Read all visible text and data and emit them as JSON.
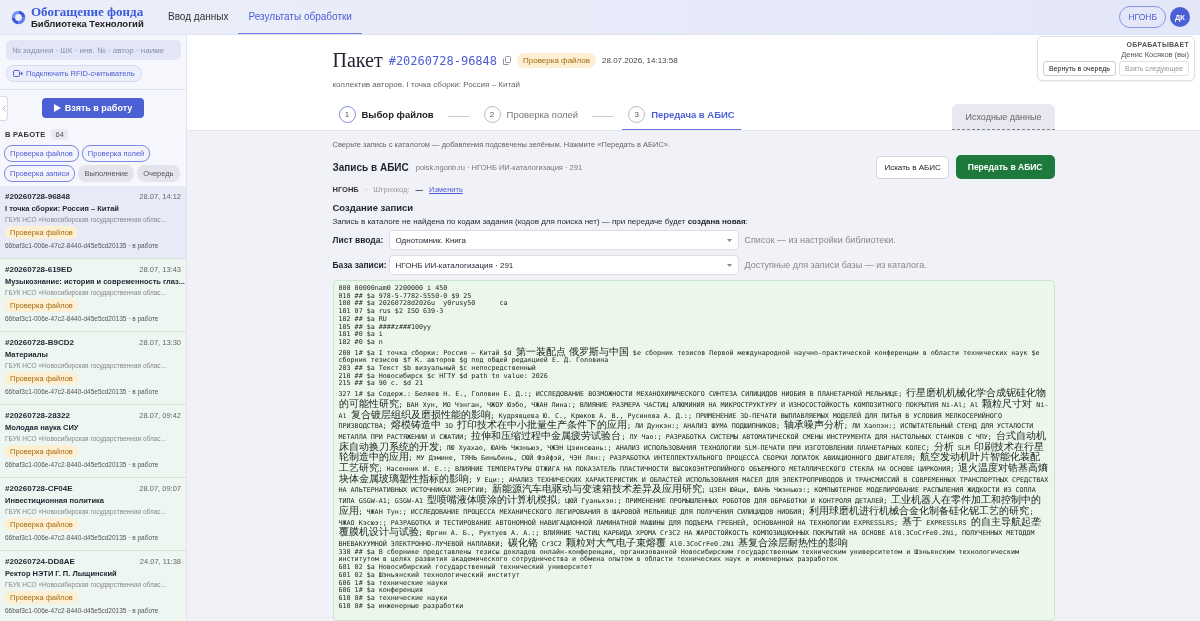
{
  "app": {
    "logo_title": "Обогащение фонда",
    "logo_subtitle": "Библиотека Технологий"
  },
  "nav": [
    {
      "label": "Ввод данных",
      "selected": false
    },
    {
      "label": "Результаты обработки",
      "selected": true
    }
  ],
  "org_badge": "НГОНБ",
  "avatar": "ДК",
  "sidebar": {
    "search": {
      "placeholder": "№ задания · ШК · инв. № · автор · наиме"
    },
    "rfid_button": "Подключить RFID-считыватель",
    "take_button": "Взять в работу",
    "section_label": "В РАБОТЕ",
    "count": "64",
    "filters": [
      {
        "label": "Проверка файлов",
        "selected": true
      },
      {
        "label": "Проверка полей",
        "selected": true
      },
      {
        "label": "Проверка записи",
        "selected": true
      },
      {
        "label": "Выполнение",
        "selected": false
      },
      {
        "label": "Очередь",
        "selected": false
      }
    ],
    "tasks": [
      {
        "id": "#20260728-96848",
        "date": "28.07, 14:12",
        "title": "I точка сборки: Россия – Китай",
        "org": "ГБУК НСО «Новосибирская государственная облас...",
        "status": "Проверка файлов",
        "meta": "66baf3c1-006e-47c2-8440-d45e5cd20135 · в работе",
        "selected": true
      },
      {
        "id": "#20260728-619ED",
        "date": "28.07, 13:43",
        "title": "Музыкознание: история и современность глаз...",
        "org": "ГБУК НСО «Новосибирская государственная облас...",
        "status": "Проверка файлов",
        "meta": "66baf3c1-006e-47c2-8440-d45e5cd20135 · в работе",
        "selected": false
      },
      {
        "id": "#20260728-B9CD2",
        "date": "28.07, 13:30",
        "title": "Материалы",
        "org": "ГБУК НСО «Новосибирская государственная облас...",
        "status": "Проверка файлов",
        "meta": "66baf3c1-006e-47c2-8440-d45e5cd20135 · в работе",
        "selected": false
      },
      {
        "id": "#20260728-28322",
        "date": "28.07, 09:42",
        "title": "Молодая наука СИУ",
        "org": "ГБУК НСО «Новосибирская государственная облас...",
        "status": "Проверка файлов",
        "meta": "66baf3c1-006e-47c2-8440-d45e5cd20135 · в работе",
        "selected": false
      },
      {
        "id": "#20260728-CF04E",
        "date": "28.07, 09:07",
        "title": "Инвестиционная политика",
        "org": "ГБУК НСО «Новосибирская государственная облас...",
        "status": "Проверка файлов",
        "meta": "66baf3c1-006e-47c2-8440-d45e5cd20135 · в работе",
        "selected": false
      },
      {
        "id": "#20260724-DD8AE",
        "date": "24.07, 11:38",
        "title": "Ректор НЭТИ Г. П. Лыщинский",
        "org": "ГБУК НСО «Новосибирская государственная облас...",
        "status": "Проверка файлов",
        "meta": "66baf3c1-006e-47c2-8440-d45e5cd20135 · в работе",
        "selected": false
      }
    ]
  },
  "package": {
    "label": "Пакет",
    "id": "#20260728-96848",
    "status": "Проверка файлов",
    "datetime": "28.07.2026, 14:13:58",
    "subtitle": "коллектив авторов. I точка сборки: Россия – Китай"
  },
  "processor": {
    "label": "ОБРАБАТЫВАЕТ",
    "name": "Денис Косяков (вы)",
    "buttons": [
      {
        "label": "Вернуть в очередь",
        "disabled": false
      },
      {
        "label": "Взять следующее",
        "disabled": true
      }
    ]
  },
  "steps": [
    {
      "number": "1",
      "label": "Выбор файлов",
      "done": true,
      "selected": false
    },
    {
      "number": "2",
      "label": "Проверка полей",
      "done": false,
      "selected": false
    },
    {
      "number": "3",
      "label": "Передача в АБИС",
      "done": false,
      "selected": true
    }
  ],
  "source_tab": "Исходные данные",
  "hint": "Сверьте запись с каталогом — добавления подсвечены зелёным. Нажмите «Передать в АБИС».",
  "abis": {
    "title": "Запись в АБИС",
    "source": "poisk.ngonb.ru · НГОНБ ИИ-каталогизация · 291",
    "search_button": "Искать в АБИС",
    "submit_button": "Передать в АБИС",
    "library": "НГОНБ",
    "separator": "·",
    "barcode_label": "Штрихкод:",
    "barcode_value": "—",
    "change_link": "Изменить"
  },
  "creation": {
    "title": "Создание записи",
    "message": "Запись в каталоге не найдена по кодам задания (кодов для поиска нет) — при передаче будет **создана новая**:",
    "fields": [
      {
        "label": "Лист ввода:",
        "value": "Однотомник. Книга",
        "hint": "Список — из настройки библиотеки."
      },
      {
        "label": "База записи:",
        "value": "НГОНБ ИИ-каталогизация · 291",
        "hint": "Доступные для записи базы — из каталога."
      }
    ]
  },
  "record": {
    "lines": [
      "000 00000nam0 2200000 i 450",
      "010 ## $a 978-5-7782-5550-0 $9 25",
      "100 ## $a 20260728d2026u  y0rusy50      ca",
      "101 07 $a rus $2 ISO 639-3",
      "102 ## $a RU",
      "105 ## $a ####z###100yy",
      "181 #0 $a i",
      "182 #0 $a n",
      "200 1# $a I точка сборки: Россия – Китай $d 第一装配点 俄罗斯与中国 $e сборник тезисов Первой международной научно-практической конференции в области технических наук $e сборник тезисов $f К. авторов $g под общей редакцией Е. Д. Головина",
      "203 ## $a Текст $b визуальный $c непосредственный",
      "210 ## $a Новосибирск $c НГТУ $d path to value: 2026",
      "215 ## $a 90 с. $d 21",
      "327 1# $a Содерж.: Беляев Н. Е., Головин Е. Д.:; ИССЛЕДОВАНИЕ ВОЗМОЖНОСТИ МЕХАНОХИМИЧЕСКОГО СИНТЕЗА СИЛИЦИДОВ НИОБИЯ В ПЛАНЕТАРНОЙ МЕЛЬНИЦЕ; 行星磨机机械化学合成铌硅化物的可能性研究; ВАН Хун, МО Чэнган, ЧЖОУ Юэбо, ЧЖАН Лина:; ВЛИЯНИЕ РАЗМЕРА ЧАСТИЦ АЛЮМИНИЯ НА МИКРОСТРУКТУРУ И ИЗНОСОСТОЙКОСТЬ КОМПОЗИТНОГО ПОКРЫТИЯ Ni-Al; Al 颗粒尺寸对 Ni-Al 复合镀层组织及磨损性能的影响; Кудрявцева Ю. С., Крюков А. В., Русинова А. Д.:; ПРИМЕНЕНИЕ 3D-ПЕЧАТИ ВЫПЛАВЛЯЕМЫХ МОДЕЛЕЙ ДЛЯ ЛИТЬЯ В УСЛОВИЯ МЕЛКОСЕРИЙНОГО ПРИЗВОДСТВА; 熔模铸造中 3D 打印技术在中小批量生产条件下的应用; ЛИ Дункэн:; АНАЛИЗ ШУМА ПОДШИПНИКОВ; 轴承噪声分析; ЛИ Хаопэн:; ИСПЫТАТЕЛЬНЫЙ СТЕНД ДЛЯ УСТАЛОСТИ МЕТАЛЛА ПРИ РАСТЯЖЕНИИ И СЖАТИИ; 拉伸和压缩过程中金属疲劳试验台; ЛУ Чао:; РАЗРАБОТКА СИСТЕМЫ АВТОМАТИЧЕСКОЙ СМЕНЫ ИНСТРУМЕНТА ДЛЯ НАСТОЛЬНЫХ СТАНКОВ С ЧПУ; 台式自动机床自动换刀系统的开发; ЛЮ Хуахао, ЮАНЬ Чжэньюэ, ЧЖЭН Цзинсюань:; АНАЛИЗ ИСПОЛЬЗОВАНИЯ ТЕХНОЛОГИИ SLM-ПЕЧАТИ ПРИ ИЗГОТОВЛЕНИИ ПЛАНЕТАРНЫХ КОЛЕС; 分析 SLM 印刷技术在行星轮制造中的应用; МУ Дэмине, ТЯНЬ Биньбинь, СЮЙ Фэйфэй, ЧЭН Лян:; РАЗРАБОТКА ИНТЕЛЛЕКТУАЛЬНОГО ПРОЦЕССА СБОРКИ ЛОПАТОК АВИАЦИОННОГО ДВИГАТЕЛЯ; 航空发动机叶片智能化装配工艺研究; Насенник И. Е.:; ВЛИЯНИЕ ТЕМПЕРАТУРЫ ОТЖИГА НА ПОКАЗАТЕЛЬ ПЛАСТИЧНОСТИ ВЫСОКОЭНТРОПИЙНОГО ОБЪЕМНОГО МЕТАЛЛИЧЕСКОГО СТЕКЛА НА ОСНОВЕ ЦИРКОНИЯ; 退火温度对锆基高熵块体金属玻璃塑性指标的影响; У Еци:; АНАЛИЗ ТЕХНИЧЕСКИХ ХАРАКТЕРИСТИК И ОБЛАСТЕЙ ИСПОЛЬЗОВАНИЯ МАСЕЛ ДЛЯ ЭЛЕКТРОПРИВОДОВ И ТРАНСМИССИЙ В СОВРЕМЕННЫХ ТРАНСПОРТНЫХ СРЕДСТВАХ НА АЛЬТЕРНАТИВНЫХ ИСТОЧНИКАХ ЭНЕРГИИ; 新能源汽车电驱动与变速箱技术差异及应用研究; ЦЗЕН Юйци, ЮАНЬ Чжэньюэ:; КОМПЬЮТЕРНОЕ МОДЕЛИРОВАНИЕ РАСПЫЛЕНИЯ ЖИДКОСТИ ИЗ СОПЛА ТИПА GSGW-A1; GSGW-A1 型喷嘴液体喷涂的计算机模拟; ЦЮЙ Гуаньхэн:; ПРИМЕНЕНИЕ ПРОМЫШЛЕННЫХ РОБОТОВ ДЛЯ ОБРАБОТКИ И КОНТРОЛЯ ДЕТАЛЕЙ; 工业机器人在零件加工和控制中的应用; ЧЖАН Тун:; ИССЛЕДОВАНИЕ ПРОЦЕССА МЕХАНИЧЕСКОГО ЛЕГИРОВАНИЯ В ШАРОВОЙ МЕЛЬНИЦЕ ДЛЯ ПОЛУЧЕНИЯ СИЛИЦИДОВ НИОБИЯ; 利用球磨机进行机械合金化制备硅化铌工艺的研究; ЧЖАО Кэсюэ:; РАЗРАБОТКА И ТЕСТИРОВАНИЕ АВТОНОМНОЙ НАВИГАЦИОННОЙ ЛАМИНАТНОЙ МАШИНЫ ДЛЯ ПОДЪЕМА ГРЕБНЕЙ, ОСНОВАННОЙ НА ТЕХНОЛОГИИ EXPRESSLRS; 基于 EXPRESSLRS 的自主导航起垄覆膜机设计与试验; Юргин А. Б., Руктуев А. А.:; ВЛИЯНИЕ ЧАСТИЦ КАРБИДА ХРОМА Cr3C2 НА ЖАРОСТОЙКОСТЬ КОМПОЗИЦИОННЫХ ПОКРЫТИЙ НА ОСНОВЕ Al0.3CoCrFe0.2Ni, ПОЛУЧЕННЫХ МЕТОДОМ ВНЕВАКУУМНОЙ ЭЛЕКТРОННО-ЛУЧЕВОЙ НАПЛАВКИ; 碳化铬 Cr3C2 颗粒对大气电子束熔覆 Al0.3CoCrFe0.2Ni 基复合涂层耐热性的影响",
      "330 ## $a В сборнике представлены тезисы докладов онлайн-конференции, организованной Новосибирским государственным техническим университетом и Шэньянским технологическим институтом в целях развития академического сотрудничества и обмена опытом в области технических наук и инженерных разработок",
      "601 02 $a Новосибирский государственный технический университет",
      "601 02 $a Шэньянский технологический институт",
      "606 1# $a технические науки",
      "606 1# $a конференция",
      "610 0# $a технические науки",
      "610 0# $a инженерные разработки"
    ]
  }
}
